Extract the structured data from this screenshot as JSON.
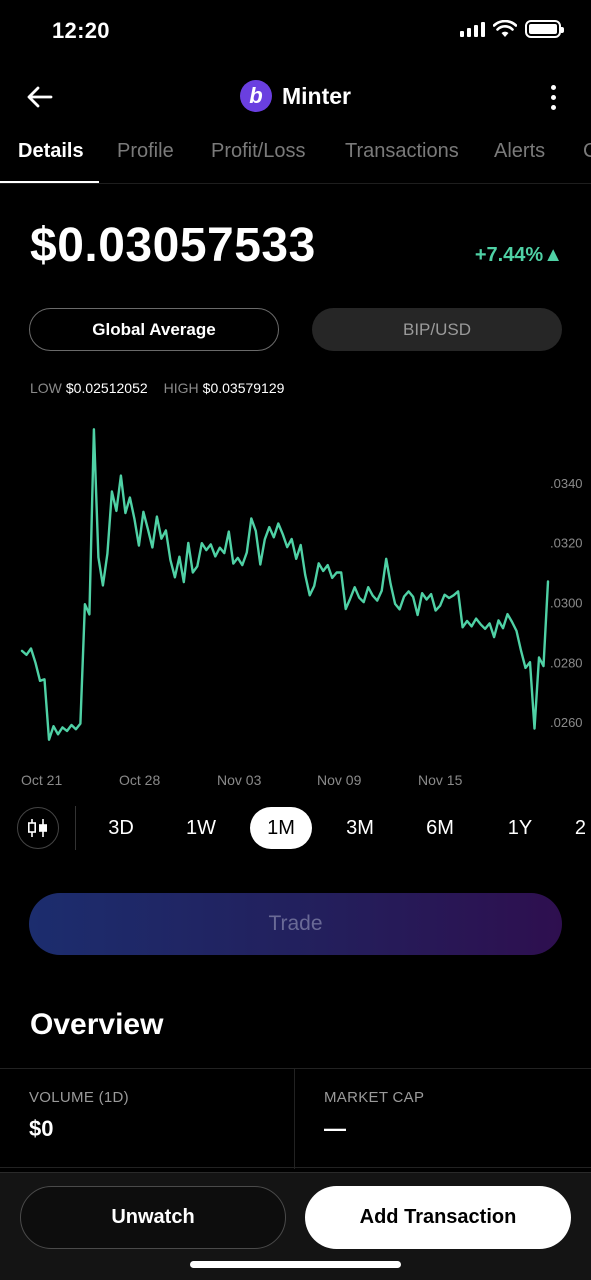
{
  "status_bar": {
    "time": "12:20"
  },
  "header": {
    "title": "Minter",
    "logo_letter": "b",
    "logo_color": "#6a3fe0"
  },
  "tabs": [
    {
      "label": "Details",
      "active": true
    },
    {
      "label": "Profile",
      "active": false
    },
    {
      "label": "Profit/Loss",
      "active": false
    },
    {
      "label": "Transactions",
      "active": false
    },
    {
      "label": "Alerts",
      "active": false
    },
    {
      "label": "C",
      "active": false
    }
  ],
  "price": {
    "value": "$0.03057533",
    "change": "+7.44%▲",
    "change_color": "#4fd1a5"
  },
  "toggles": {
    "primary": "Global Average",
    "secondary": "BIP/USD"
  },
  "lowhigh": {
    "low_label": "LOW",
    "low_value": "$0.02512052",
    "high_label": "HIGH",
    "high_value": "$0.03579129"
  },
  "chart_data": {
    "type": "line",
    "line_color": "#4fd1a5",
    "x_tick_labels": [
      "Oct 21",
      "Oct 28",
      "Nov 03",
      "Nov 09",
      "Nov 15"
    ],
    "y_tick_labels": [
      ".0340",
      ".0320",
      ".0300",
      ".0280",
      ".0260"
    ],
    "y_ticks": [
      0.034,
      0.032,
      0.03,
      0.028,
      0.026
    ],
    "ylim": [
      0.0254,
      0.0358
    ],
    "values": [
      0.02838,
      0.02825,
      0.02846,
      0.02798,
      0.02738,
      0.02743,
      0.02541,
      0.02586,
      0.02559,
      0.02582,
      0.0257,
      0.0259,
      0.02576,
      0.02595,
      0.02994,
      0.0296,
      0.03579,
      0.03151,
      0.03057,
      0.03163,
      0.03371,
      0.03306,
      0.03424,
      0.03299,
      0.03351,
      0.0328,
      0.0319,
      0.03303,
      0.03245,
      0.03184,
      0.03287,
      0.03213,
      0.03241,
      0.03142,
      0.03084,
      0.03153,
      0.03068,
      0.03199,
      0.031,
      0.03121,
      0.03198,
      0.03175,
      0.03194,
      0.03154,
      0.03183,
      0.03165,
      0.03237,
      0.0313,
      0.03149,
      0.03125,
      0.03167,
      0.03281,
      0.03239,
      0.03127,
      0.03211,
      0.03252,
      0.03218,
      0.03264,
      0.03228,
      0.03185,
      0.03212,
      0.03146,
      0.03192,
      0.03092,
      0.03024,
      0.03055,
      0.03131,
      0.03105,
      0.03125,
      0.03082,
      0.031,
      0.031,
      0.02978,
      0.03013,
      0.03051,
      0.03016,
      0.03001,
      0.03051,
      0.03023,
      0.03006,
      0.03039,
      0.03146,
      0.03062,
      0.02995,
      0.02977,
      0.0302,
      0.03037,
      0.03019,
      0.02958,
      0.03031,
      0.0301,
      0.03028,
      0.02973,
      0.02989,
      0.03026,
      0.03015,
      0.03024,
      0.03037,
      0.02917,
      0.02938,
      0.0292,
      0.02946,
      0.02927,
      0.02912,
      0.0293,
      0.02884,
      0.0294,
      0.02914,
      0.02961,
      0.02935,
      0.02905,
      0.02839,
      0.02781,
      0.028,
      0.02578,
      0.02816,
      0.02787,
      0.0307
    ]
  },
  "ranges": [
    {
      "label": "3D",
      "active": false
    },
    {
      "label": "1W",
      "active": false
    },
    {
      "label": "1M",
      "active": true
    },
    {
      "label": "3M",
      "active": false
    },
    {
      "label": "6M",
      "active": false
    },
    {
      "label": "1Y",
      "active": false
    },
    {
      "label": "2",
      "active": false
    }
  ],
  "trade_label": "Trade",
  "overview": {
    "title": "Overview",
    "volume_label": "VOLUME (1D)",
    "volume_value": "$0",
    "market_cap_label": "MARKET CAP",
    "market_cap_value": "—"
  },
  "bottom": {
    "unwatch_label": "Unwatch",
    "add_label": "Add Transaction"
  }
}
